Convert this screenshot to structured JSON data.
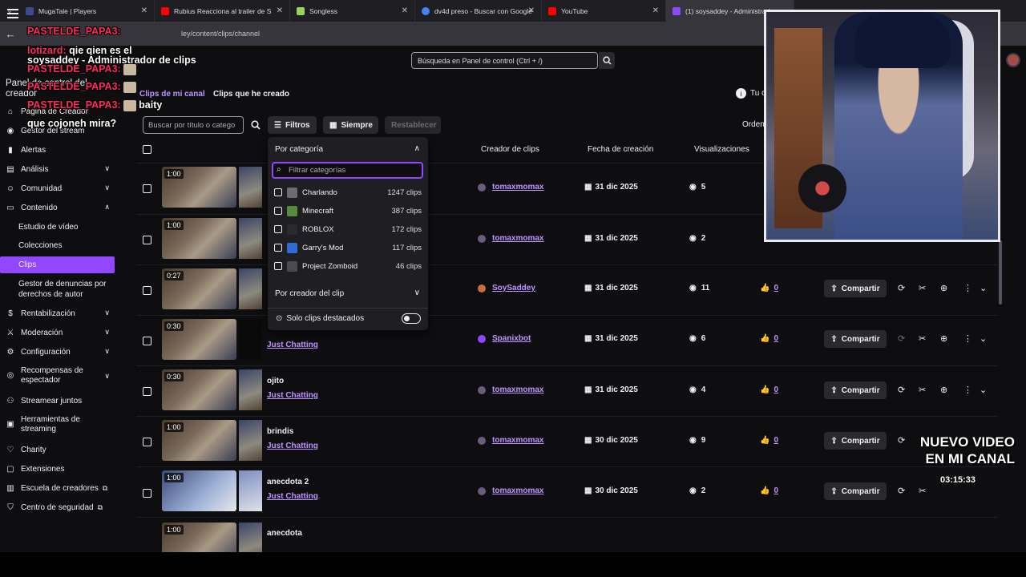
{
  "browser": {
    "tabs": [
      {
        "label": "MugaTale | Players",
        "color": "#3d4b8c"
      },
      {
        "label": "Rubius Reacciona al trailer de S",
        "color": "#ff0000"
      },
      {
        "label": "Songless",
        "color": "#9bd35a"
      },
      {
        "label": "dv4d preso - Buscar con Google",
        "color": "#4285f4"
      },
      {
        "label": "YouTube",
        "color": "#ff0000"
      },
      {
        "label": "(1) soysaddey - Administrador",
        "color": "#9147ff"
      }
    ],
    "url": "ley/content/clips/channel"
  },
  "topbar": {
    "search_placeholder": "Búsqueda en Panel de control (Ctrl + /)"
  },
  "sidebar": {
    "title": "Panel de control del creador",
    "items": [
      {
        "label": "Página de Creador",
        "icon": "home-icon"
      },
      {
        "label": "Gestor del stream",
        "icon": "stream-icon"
      },
      {
        "label": "Alertas",
        "icon": "alert-icon"
      },
      {
        "label": "Análisis",
        "icon": "chart-icon",
        "chev": "∨"
      },
      {
        "label": "Comunidad",
        "icon": "community-icon",
        "chev": "∨"
      },
      {
        "label": "Contenido",
        "icon": "content-icon",
        "chev": "∧"
      }
    ],
    "sub_items": [
      "Estudio de vídeo",
      "Colecciones",
      "Clips",
      "Gestor de denuncias por derechos de autor"
    ],
    "items_bottom": [
      {
        "label": "Rentabilización",
        "icon": "money-icon",
        "chev": "∨"
      },
      {
        "label": "Moderación",
        "icon": "sword-icon",
        "chev": "∨"
      },
      {
        "label": "Configuración",
        "icon": "gear-icon",
        "chev": "∨"
      },
      {
        "label": "Recompensas de espectador",
        "icon": "reward-icon",
        "chev": "∨"
      },
      {
        "label": "Streamear juntos",
        "icon": "together-icon"
      },
      {
        "label": "Herramientas de streaming",
        "icon": "tools-icon"
      },
      {
        "label": "Charity",
        "icon": "heart-icon"
      },
      {
        "label": "Extensiones",
        "icon": "extension-icon"
      },
      {
        "label": "Escuela de creadores",
        "icon": "school-icon",
        "ext": "⧉"
      },
      {
        "label": "Centro de seguridad",
        "icon": "shield-icon",
        "ext": "⧉"
      }
    ]
  },
  "main": {
    "tabs": [
      "Clips de mi canal",
      "Clips que he creado"
    ],
    "tu_label": "Tu c",
    "filter_placeholder": "Buscar por título o catego",
    "filters_label": "Filtros",
    "always_label": "Siempre",
    "reset_label": "Restablecer",
    "order_label": "Orden",
    "columns": [
      "Creador de clips",
      "Fecha de creación",
      "Visualizaciones"
    ],
    "share_label": "Compartir",
    "rows": [
      {
        "duration": "1:00",
        "title": "",
        "category": "",
        "creator": "tomaxmomax",
        "date": "31 dic 2025",
        "views": "5",
        "likes": ""
      },
      {
        "duration": "1:00",
        "title": "",
        "category": "",
        "creator": "tomaxmomax",
        "date": "31 dic 2025",
        "views": "2",
        "likes": ""
      },
      {
        "duration": "0:27",
        "title": "",
        "category": "",
        "creator": "SoySaddey",
        "date": "31 dic 2025",
        "views": "11",
        "likes": "0"
      },
      {
        "duration": "0:30",
        "title": "",
        "category": "Just Chatting",
        "creator": "Spanixbot",
        "date": "31 dic 2025",
        "views": "6",
        "likes": "0"
      },
      {
        "duration": "0:30",
        "title": "ojito",
        "category": "Just Chatting",
        "creator": "tomaxmomax",
        "date": "31 dic 2025",
        "views": "4",
        "likes": "0"
      },
      {
        "duration": "1:00",
        "title": "brindis",
        "category": "Just Chatting",
        "creator": "tomaxmomax",
        "date": "30 dic 2025",
        "views": "9",
        "likes": "0"
      },
      {
        "duration": "1:00",
        "title": "anecdota 2",
        "category": "Just Chatting",
        "creator": "tomaxmomax",
        "date": "30 dic 2025",
        "views": "2",
        "likes": "0"
      },
      {
        "duration": "1:00",
        "title": "anecdota",
        "category": "",
        "creator": "",
        "date": "",
        "views": "",
        "likes": ""
      }
    ]
  },
  "dropdown": {
    "header": "Por categoría",
    "search_placeholder": "Filtrar categorías",
    "categories": [
      {
        "name": "Charlando",
        "count": "1247 clips",
        "color": "#6b6b74"
      },
      {
        "name": "Minecraft",
        "count": "387 clips",
        "color": "#5a8a3c"
      },
      {
        "name": "ROBLOX",
        "count": "172 clips",
        "color": "#2a2a30"
      },
      {
        "name": "Garry's Mod",
        "count": "117 clips",
        "color": "#2f6ad6"
      },
      {
        "name": "Project Zomboid",
        "count": "46 clips",
        "color": "#4a4a52"
      }
    ],
    "creator_label": "Por creador del clip",
    "featured_label": "Solo clips destacados"
  },
  "overlay": {
    "chat": [
      {
        "user": "PASTELDE_PAPA3:",
        "msg": ""
      },
      {
        "user": "lotizard:",
        "msg": "qie qien es el"
      },
      {
        "user": "",
        "msg": "soysaddey - Administrador de clips"
      },
      {
        "user": "PASTELDE_PAPA3:",
        "msg": ""
      },
      {
        "user": "PASTELDE_PAPA3:",
        "msg": ""
      },
      {
        "user": "PASTELDE_PAPA3:",
        "msg": "baity"
      },
      {
        "user": "",
        "msg": "que cojoneh mira?"
      }
    ],
    "note": "NUEVO VIDEO EN MI CANAL",
    "time": "03:15:33"
  }
}
